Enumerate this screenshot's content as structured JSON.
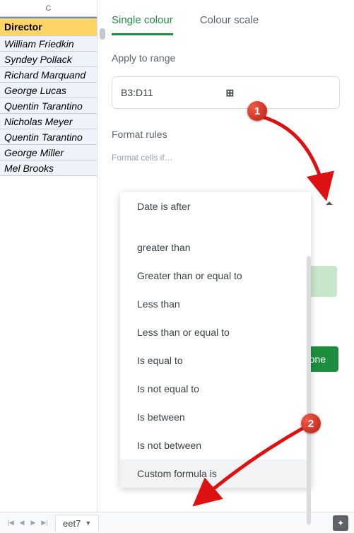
{
  "column_header": "C",
  "header_cell": "Director",
  "rows": [
    "William Friedkin",
    "Syndey Pollack",
    "Richard Marquand",
    "George Lucas",
    "Quentin Tarantino",
    "Nicholas Meyer",
    "Quentin Tarantino",
    "George Miller",
    "Mel Brooks"
  ],
  "tabs": {
    "single": "Single colour",
    "scale": "Colour scale"
  },
  "apply_label": "Apply to range",
  "range_value": "B3:D11",
  "rules_label": "Format rules",
  "format_if_label": "Format cells if…",
  "done_label": "Done",
  "dropdown": [
    "Date is after",
    "greater than",
    "Greater than or equal to",
    "Less than",
    "Less than or equal to",
    "Is equal to",
    "Is not equal to",
    "Is between",
    "Is not between",
    "Custom formula is"
  ],
  "callouts": {
    "one": "1",
    "two": "2"
  },
  "sheet_tab": "eet7"
}
